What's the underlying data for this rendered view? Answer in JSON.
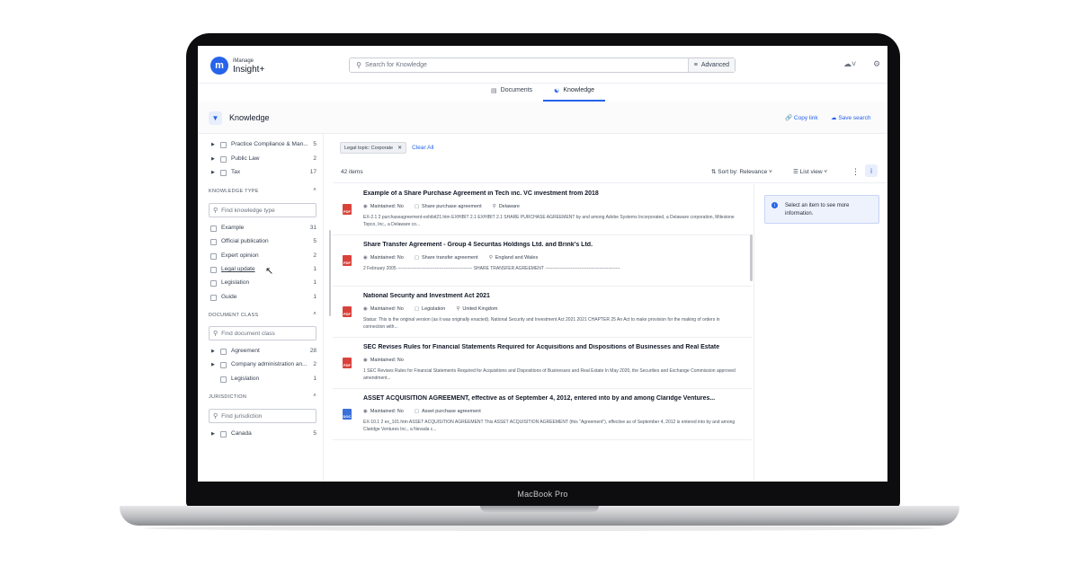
{
  "device": {
    "label": "MacBook Pro"
  },
  "app": {
    "brand_small": "iManage",
    "brand_name": "Insight+",
    "logo_letter": "m",
    "search_placeholder": "Search for Knowledge",
    "advanced_label": "Advanced"
  },
  "tabs": [
    {
      "label": "Documents",
      "active": false
    },
    {
      "label": "Knowledge",
      "active": true
    }
  ],
  "header": {
    "title": "Knowledge",
    "copy_link": "Copy link",
    "save_search": "Save search"
  },
  "sidebar": {
    "top_items": [
      {
        "label": "Practice Compliance & Man...",
        "count": "5"
      },
      {
        "label": "Public Law",
        "count": "2"
      },
      {
        "label": "Tax",
        "count": "17"
      }
    ],
    "knowledge_type": {
      "title": "KNOWLEDGE TYPE",
      "placeholder": "Find knowledge type",
      "items": [
        {
          "label": "Example",
          "count": "31"
        },
        {
          "label": "Official publication",
          "count": "5"
        },
        {
          "label": "Expert opinion",
          "count": "2"
        },
        {
          "label": "Legal update",
          "count": "1"
        },
        {
          "label": "Legislation",
          "count": "1"
        },
        {
          "label": "Guide",
          "count": "1"
        }
      ]
    },
    "document_class": {
      "title": "DOCUMENT CLASS",
      "placeholder": "Find document class",
      "items": [
        {
          "label": "Agreement",
          "count": "28"
        },
        {
          "label": "Company administration an...",
          "count": "2"
        },
        {
          "label": "Legislation",
          "count": "1"
        }
      ]
    },
    "jurisdiction": {
      "title": "JURISDICTION",
      "placeholder": "Find jurisdiction",
      "items": [
        {
          "label": "Canada",
          "count": "5"
        }
      ]
    }
  },
  "filters": {
    "chip": "Legal topic: Corporate",
    "clear_all": "Clear All"
  },
  "results_bar": {
    "count": "42 items",
    "sort": "Sort by: Relevance",
    "view": "List view"
  },
  "results": [
    {
      "title": "Example of a Share Purchase Agreement in Tech inc. VC investment from 2018",
      "maintained": "Maintained: No",
      "tag": "Share purchase agreement",
      "location": "Delaware",
      "snippet": "EX-2.1 2 purchaseagreement-exhibit21.htm EXHIBIT 2.1 EXHIBIT 2.1 SHARE PURCHASE AGREEMENT by and among Adobe Systems Incorporated, a Delaware corporation, Milestone Topco, Inc., a Delaware co...",
      "icon": "PDF"
    },
    {
      "title": "Share Transfer Agreement - Group 4 Securitas Holdings Ltd. and Brink's Ltd.",
      "maintained": "Maintained: No",
      "tag": "Share transfer agreement",
      "location": "England and Wales",
      "snippet": "2 February 2005 -------------------------------------------------- SHARE TRANSFER AGREEMENT --------------------------------------------------",
      "icon": "PDF"
    },
    {
      "title": "National Security and Investment Act 2021",
      "maintained": "Maintained: No",
      "tag": "Legislation",
      "location": "United Kingdom",
      "snippet": "Status: This is the original version (as it was originally enacted). National Security and Investment Act 2021 2021 CHAPTER 25 An Act to make provision for the making of orders in connection with...",
      "icon": "PDF"
    },
    {
      "title": "SEC Revises Rules for Financial Statements Required for Acquisitions and Dispositions of Businesses and Real Estate",
      "maintained": "Maintained: No",
      "tag": "",
      "location": "",
      "snippet": "1 SEC Revises Rules for Financial Statements Required for Acquisitions and Dispositions of Businesses and Real Estate In May 2020, the Securities and Exchange Commission approved amendment...",
      "icon": "PDF"
    },
    {
      "title": "ASSET ACQUISITION AGREEMENT, effective as of September 4, 2012, entered into by and among Claridge Ventures...",
      "maintained": "Maintained: No",
      "tag": "Asset purchase agreement",
      "location": "",
      "snippet": "EX-10.1 2 ex_101.htm ASSET ACQUISITION AGREEMENT This ASSET ACQUISITION AGREEMENT (this \"Agreement\"), effective as of September 4, 2012 is entered into by and among Claridge Ventures Inc., a Nevada c...",
      "icon": "DOC"
    }
  ],
  "detail_panel": {
    "message": "Select an item to see more information."
  }
}
